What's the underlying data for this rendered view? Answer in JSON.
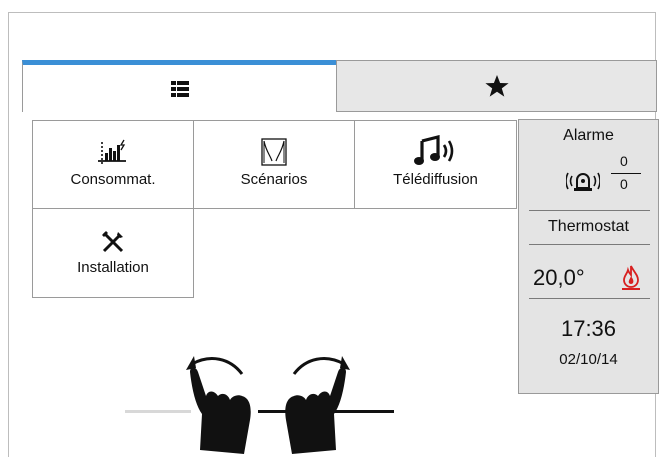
{
  "tabs": [
    {
      "icon": "grid-icon"
    },
    {
      "icon": "star-icon"
    }
  ],
  "tiles": [
    {
      "label": "Consommat.",
      "icon": "consumption-chart-icon"
    },
    {
      "label": "Scénarios",
      "icon": "curtain-icon"
    },
    {
      "label": "Télédiffusion",
      "icon": "music-note-icon"
    },
    {
      "label": "Installation",
      "icon": "tools-icon"
    }
  ],
  "side_panel": {
    "alarm_title": "Alarme",
    "alarm_numerator": "0",
    "alarm_denominator": "0",
    "thermostat_title": "Thermostat",
    "temperature": "20,0°",
    "time": "17:36",
    "date": "02/10/14"
  },
  "colors": {
    "accent": "#3b8fd6",
    "flame": "#d81f1f",
    "panel": "#e4e4e4"
  }
}
